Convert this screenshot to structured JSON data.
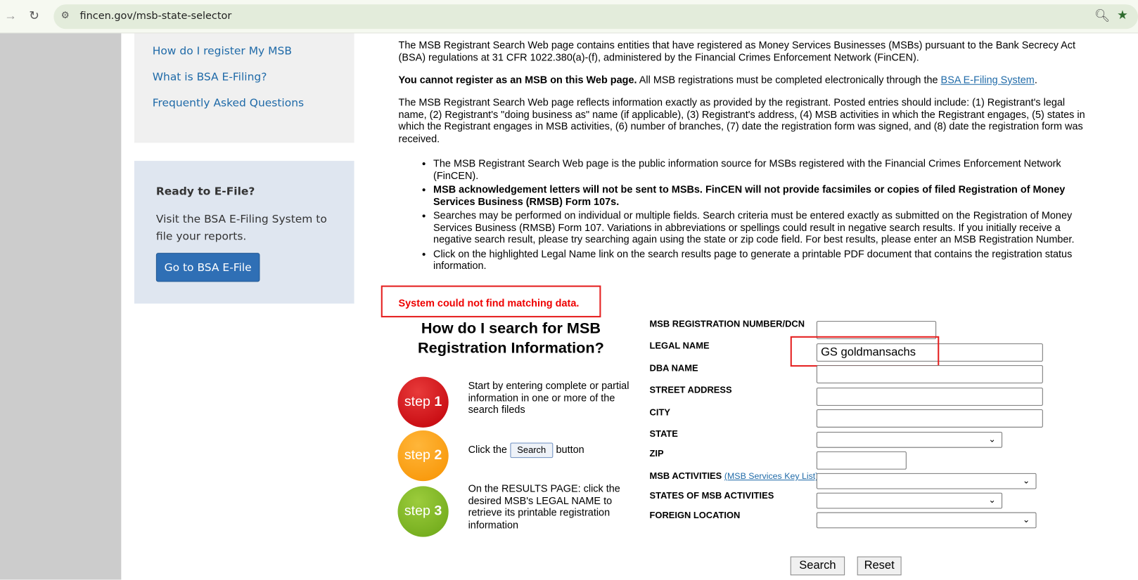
{
  "browser": {
    "url": "fincen.gov/msb-state-selector"
  },
  "sidebar": {
    "links": [
      "How do I register My MSB",
      "What is BSA E-Filing?",
      "Frequently Asked Questions"
    ],
    "efile": {
      "title": "Ready to E-File?",
      "text": "Visit the BSA E-Filing System to file your reports.",
      "button": "Go to BSA E-File"
    }
  },
  "intro": {
    "p1": "The MSB Registrant Search Web page contains entities that have registered as Money Services Businesses (MSBs) pursuant to the Bank Secrecy Act (BSA) regulations at 31 CFR 1022.380(a)-(f), administered by the Financial Crimes Enforcement Network (FinCEN).",
    "p2_bold": "You cannot register as an MSB on this Web page.",
    "p2_rest": " All MSB registrations must be completed electronically through the ",
    "p2_link": "BSA E-Filing System",
    "p2_end": ".",
    "p3": "The MSB Registrant Search Web page reflects information exactly as provided by the registrant. Posted entries should include: (1) Registrant's legal name, (2) Registrant's \"doing business as\" name (if applicable), (3) Registrant's address, (4) MSB activities in which the Registrant engages, (5) states in which the Registrant engages in MSB activities, (6) number of branches, (7) date the registration form was signed, and (8) date the registration form was received.",
    "bullets": [
      "The MSB Registrant Search Web page is the public information source for MSBs registered with the Financial Crimes Enforcement Network (FinCEN).",
      "MSB acknowledgement letters will not be sent to MSBs. FinCEN will not provide facsimiles or copies of filed Registration of Money Services Business (RMSB) Form 107s.",
      "Searches may be performed on individual or multiple fields. Search criteria must be entered exactly as submitted on the Registration of Money Services Business (RMSB) Form 107. Variations in abbreviations or spellings could result in negative search results. If you initially receive a negative search result, please try searching again using the state or zip code field. For best results, please enter an MSB Registration Number.",
      "Click on the highlighted Legal Name link on the search results page to generate a printable PDF document that contains the registration status information."
    ]
  },
  "error": "System could not find matching data.",
  "howto": {
    "title": "How do I search for MSB Registration Information?",
    "steps": [
      {
        "badge": "step",
        "num": "1",
        "text": "Start by entering complete or partial information in one or more of the search fileds"
      },
      {
        "badge": "step",
        "num": "2",
        "pre": "Click the",
        "btn": "Search",
        "post": "button"
      },
      {
        "badge": "step",
        "num": "3",
        "text": "On the RESULTS PAGE: click the desired MSB's LEGAL NAME to retrieve its printable registration information"
      }
    ]
  },
  "form": {
    "labels": {
      "regnum": "MSB REGISTRATION NUMBER/DCN",
      "legal": "LEGAL NAME",
      "dba": "DBA NAME",
      "street": "STREET ADDRESS",
      "city": "CITY",
      "state": "STATE",
      "zip": "ZIP",
      "activities": "MSB ACTIVITIES",
      "activities_link": "(MSB Services Key List)",
      "states_act": "STATES OF MSB ACTIVITIES",
      "foreign": "FOREIGN LOCATION"
    },
    "values": {
      "legal": "GS goldmansachs"
    },
    "search": "Search",
    "reset": "Reset"
  }
}
